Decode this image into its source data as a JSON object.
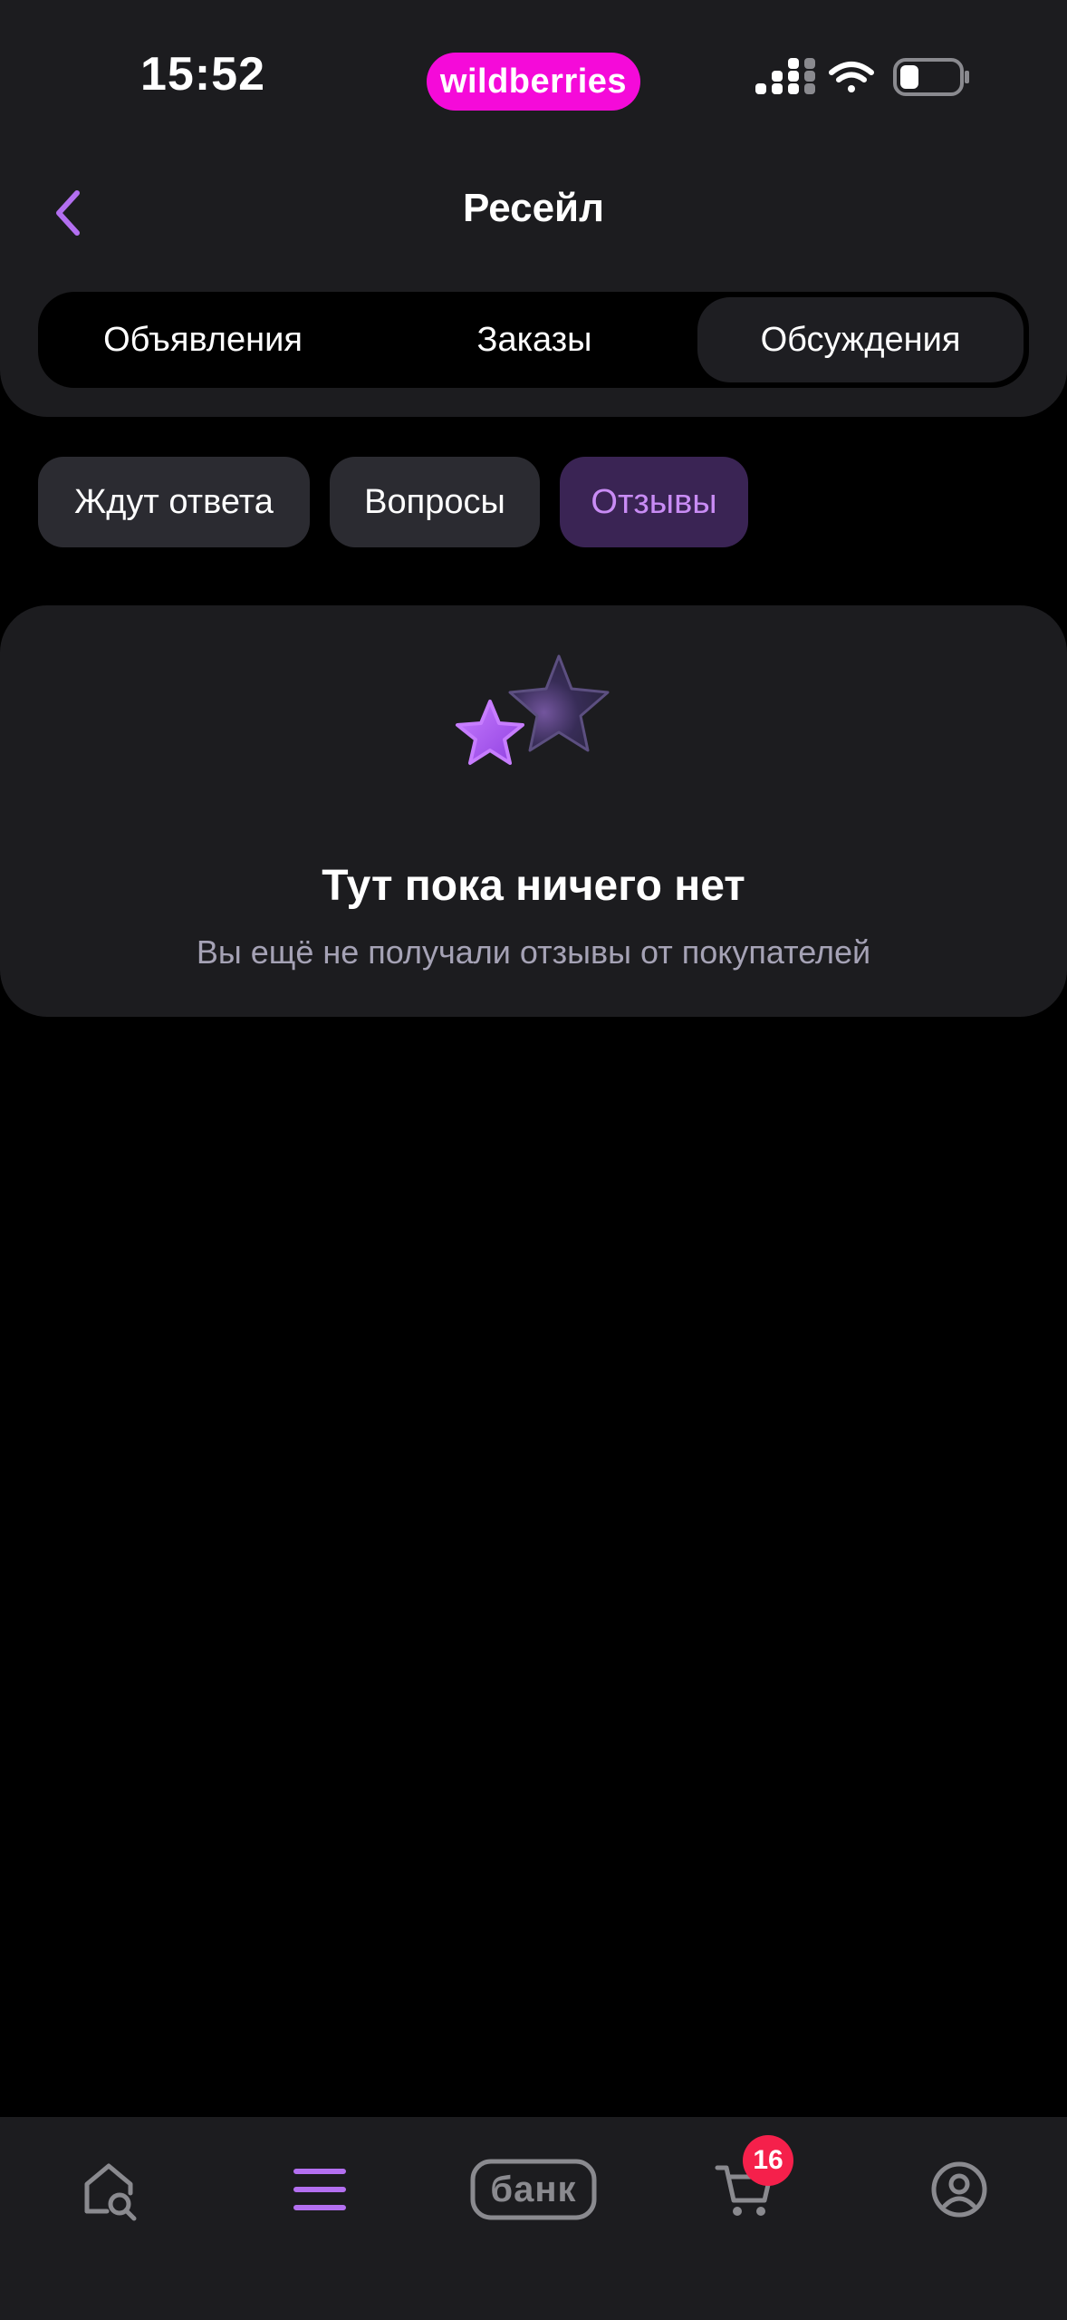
{
  "status_bar": {
    "time": "15:52",
    "brand": "wildberries"
  },
  "header": {
    "title": "Ресейл"
  },
  "tabs": [
    {
      "label": "Объявления",
      "active": false
    },
    {
      "label": "Заказы",
      "active": false
    },
    {
      "label": "Обсуждения",
      "active": true
    }
  ],
  "filters": [
    {
      "label": "Ждут ответа",
      "active": false
    },
    {
      "label": "Вопросы",
      "active": false
    },
    {
      "label": "Отзывы",
      "active": true
    }
  ],
  "empty_state": {
    "icon": "stars-icon",
    "title": "Тут пока ничего нет",
    "subtitle": "Вы ещё не получали отзывы от покупателей"
  },
  "bottom_nav": {
    "items": [
      {
        "icon": "home-search-icon"
      },
      {
        "icon": "menu-icon",
        "active": true
      },
      {
        "icon": "bank-icon",
        "label": "банк"
      },
      {
        "icon": "cart-icon",
        "badge": "16"
      },
      {
        "icon": "profile-icon"
      }
    ]
  },
  "colors": {
    "accent": "#b36ff0",
    "brand": "#f50ad9",
    "badge": "#f5204b",
    "surface": "#1c1c1f",
    "background": "#000000"
  }
}
